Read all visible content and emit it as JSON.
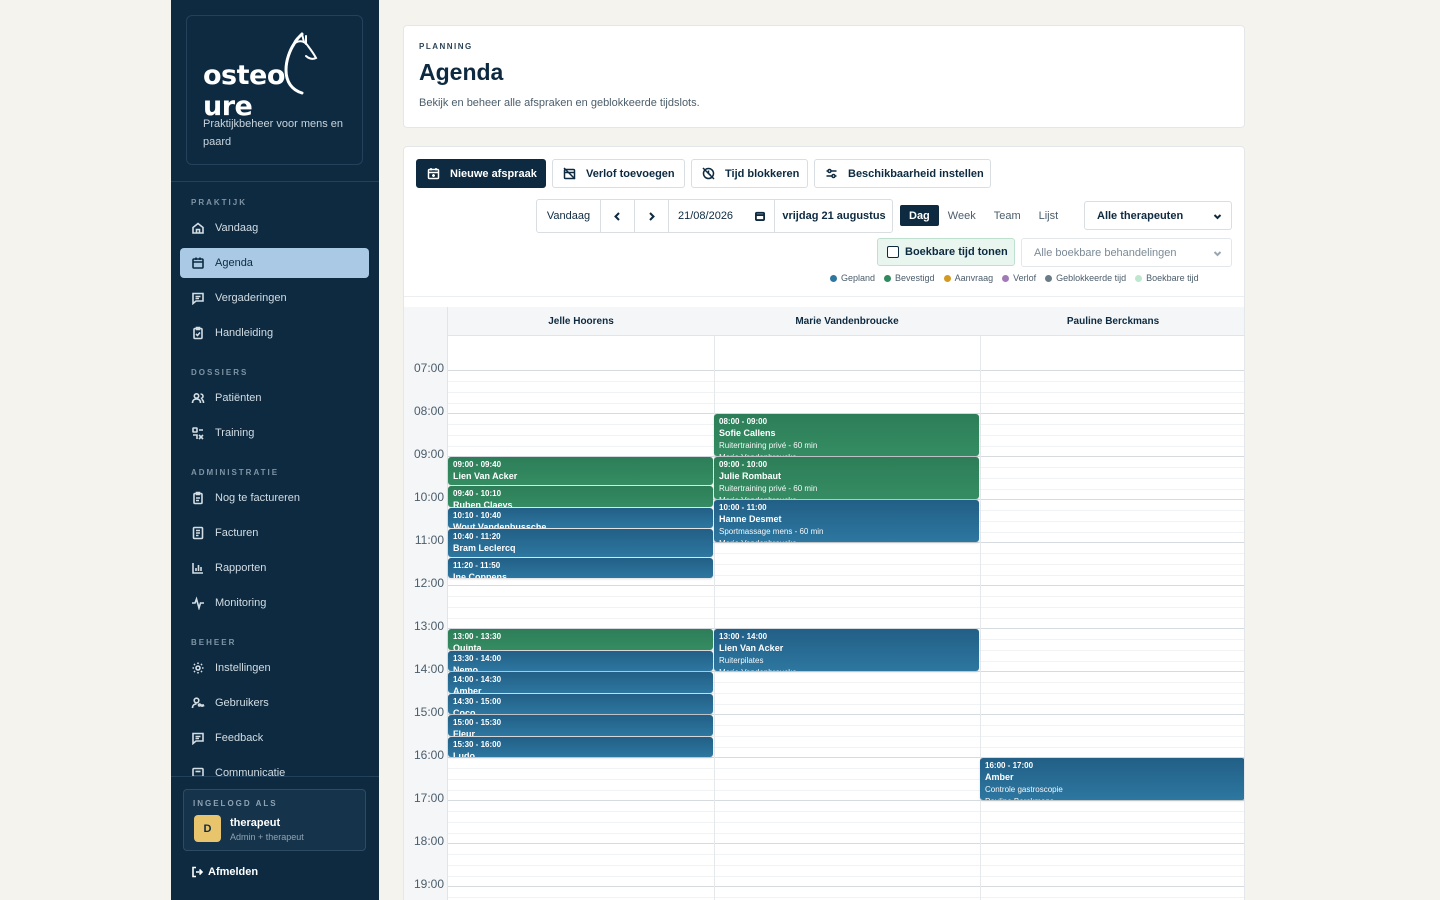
{
  "brand": {
    "logo_text": "osteoCure",
    "tagline": "Praktijkbeheer voor mens en paard"
  },
  "sidebar": {
    "sections": [
      {
        "title": "PRAKTIJK",
        "items": [
          {
            "label": "Vandaag",
            "icon": "home-icon"
          },
          {
            "label": "Agenda",
            "icon": "calendar-icon",
            "active": true
          },
          {
            "label": "Vergaderingen",
            "icon": "chat-icon"
          },
          {
            "label": "Handleiding",
            "icon": "clipboard-icon"
          }
        ]
      },
      {
        "title": "DOSSIERS",
        "items": [
          {
            "label": "Patiënten",
            "icon": "users-icon"
          },
          {
            "label": "Training",
            "icon": "training-icon"
          }
        ]
      },
      {
        "title": "ADMINISTRATIE",
        "items": [
          {
            "label": "Nog te factureren",
            "icon": "clipboard-icon"
          },
          {
            "label": "Facturen",
            "icon": "invoice-icon"
          },
          {
            "label": "Rapporten",
            "icon": "chart-icon"
          },
          {
            "label": "Monitoring",
            "icon": "pulse-icon"
          }
        ]
      },
      {
        "title": "BEHEER",
        "items": [
          {
            "label": "Instellingen",
            "icon": "gear-icon"
          },
          {
            "label": "Gebruikers",
            "icon": "user-key-icon"
          },
          {
            "label": "Feedback",
            "icon": "chat-icon"
          },
          {
            "label": "Communicatie",
            "icon": "message-icon"
          }
        ]
      }
    ],
    "user": {
      "label": "INGELOGD ALS",
      "initial": "D",
      "name": "therapeut",
      "role": "Admin + therapeut"
    },
    "logout": "Afmelden"
  },
  "header": {
    "eyebrow": "PLANNING",
    "title": "Agenda",
    "subtitle": "Bekijk en beheer alle afspraken en geblokkeerde tijdslots."
  },
  "toolbar": {
    "new_appointment": "Nieuwe afspraak",
    "add_leave": "Verlof toevoegen",
    "block_time": "Tijd blokkeren",
    "set_availability": "Beschikbaarheid instellen"
  },
  "nav": {
    "today": "Vandaag",
    "date_value": "21/08/2026",
    "date_label": "vrijdag 21 augustus",
    "views": [
      "Dag",
      "Week",
      "Team",
      "Lijst"
    ],
    "active_view": "Dag",
    "therapist_select": "Alle therapeuten",
    "show_bookable": "Boekbare tijd tonen",
    "treatment_select": "Alle boekbare behandelingen"
  },
  "legend": [
    {
      "label": "Gepland",
      "color": "#2d77a0"
    },
    {
      "label": "Bevestigd",
      "color": "#2e8b5e"
    },
    {
      "label": "Aanvraag",
      "color": "#d49a1f"
    },
    {
      "label": "Verlof",
      "color": "#a07bb8"
    },
    {
      "label": "Geblokkeerde tijd",
      "color": "#6b7c89"
    },
    {
      "label": "Boekbare tijd",
      "color": "#bfe6cf"
    }
  ],
  "calendar": {
    "columns": [
      "Jelle Hoorens",
      "Marie Vandenbroucke",
      "Pauline Berckmans"
    ],
    "hours": [
      "07:00",
      "08:00",
      "09:00",
      "10:00",
      "11:00",
      "12:00",
      "13:00",
      "14:00",
      "15:00",
      "16:00",
      "17:00",
      "18:00",
      "19:00"
    ],
    "events": [
      {
        "col": 1,
        "start": "08:00",
        "end": "09:00",
        "time": "08:00 - 09:00",
        "name": "Sofie Callens",
        "detail": "Ruitertraining privé - 60 min",
        "extra": "Marie Vandenbroucke",
        "status": "bevestigd"
      },
      {
        "col": 1,
        "start": "09:00",
        "end": "10:00",
        "time": "09:00 - 10:00",
        "name": "Julie Rombaut",
        "detail": "Ruitertraining privé - 60 min",
        "extra": "Marie Vandenbroucke",
        "status": "bevestigd"
      },
      {
        "col": 1,
        "start": "10:00",
        "end": "11:00",
        "time": "10:00 - 11:00",
        "name": "Hanne Desmet",
        "detail": "Sportmassage mens - 60 min",
        "extra": "Marie Vandenbroucke",
        "status": "gepland"
      },
      {
        "col": 1,
        "start": "13:00",
        "end": "14:00",
        "time": "13:00 - 14:00",
        "name": "Lien Van Acker",
        "detail": "Ruiterpilates",
        "extra": "Marie Vandenbroucke",
        "status": "gepland"
      },
      {
        "col": 0,
        "start": "09:00",
        "end": "09:40",
        "time": "09:00 - 09:40",
        "name": "Lien Van Acker",
        "detail": "",
        "extra": "",
        "status": "bevestigd"
      },
      {
        "col": 0,
        "start": "09:40",
        "end": "10:10",
        "time": "09:40 - 10:10",
        "name": "Ruben Claeys",
        "detail": "",
        "extra": "",
        "status": "bevestigd"
      },
      {
        "col": 0,
        "start": "10:10",
        "end": "10:40",
        "time": "10:10 - 10:40",
        "name": "Wout Vandenbussche",
        "detail": "",
        "extra": "",
        "status": "gepland"
      },
      {
        "col": 0,
        "start": "10:40",
        "end": "11:20",
        "time": "10:40 - 11:20",
        "name": "Bram Leclercq",
        "detail": "",
        "extra": "",
        "status": "gepland"
      },
      {
        "col": 0,
        "start": "11:20",
        "end": "11:50",
        "time": "11:20 - 11:50",
        "name": "Ine Coppens",
        "detail": "",
        "extra": "",
        "status": "gepland"
      },
      {
        "col": 0,
        "start": "13:00",
        "end": "13:30",
        "time": "13:00 - 13:30",
        "name": "Quinta",
        "detail": "",
        "extra": "",
        "status": "bevestigd"
      },
      {
        "col": 0,
        "start": "13:30",
        "end": "14:00",
        "time": "13:30 - 14:00",
        "name": "Nemo",
        "detail": "",
        "extra": "",
        "status": "gepland"
      },
      {
        "col": 0,
        "start": "14:00",
        "end": "14:30",
        "time": "14:00 - 14:30",
        "name": "Amber",
        "detail": "",
        "extra": "",
        "status": "gepland"
      },
      {
        "col": 0,
        "start": "14:30",
        "end": "15:00",
        "time": "14:30 - 15:00",
        "name": "Coco",
        "detail": "",
        "extra": "",
        "status": "gepland"
      },
      {
        "col": 0,
        "start": "15:00",
        "end": "15:30",
        "time": "15:00 - 15:30",
        "name": "Fleur",
        "detail": "",
        "extra": "",
        "status": "gepland"
      },
      {
        "col": 0,
        "start": "15:30",
        "end": "16:00",
        "time": "15:30 - 16:00",
        "name": "Ludo",
        "detail": "",
        "extra": "",
        "status": "gepland"
      },
      {
        "col": 2,
        "start": "16:00",
        "end": "17:00",
        "time": "16:00 - 17:00",
        "name": "Amber",
        "detail": "Controle gastroscopie",
        "extra": "Pauline Berckmans",
        "status": "gepland"
      }
    ]
  }
}
